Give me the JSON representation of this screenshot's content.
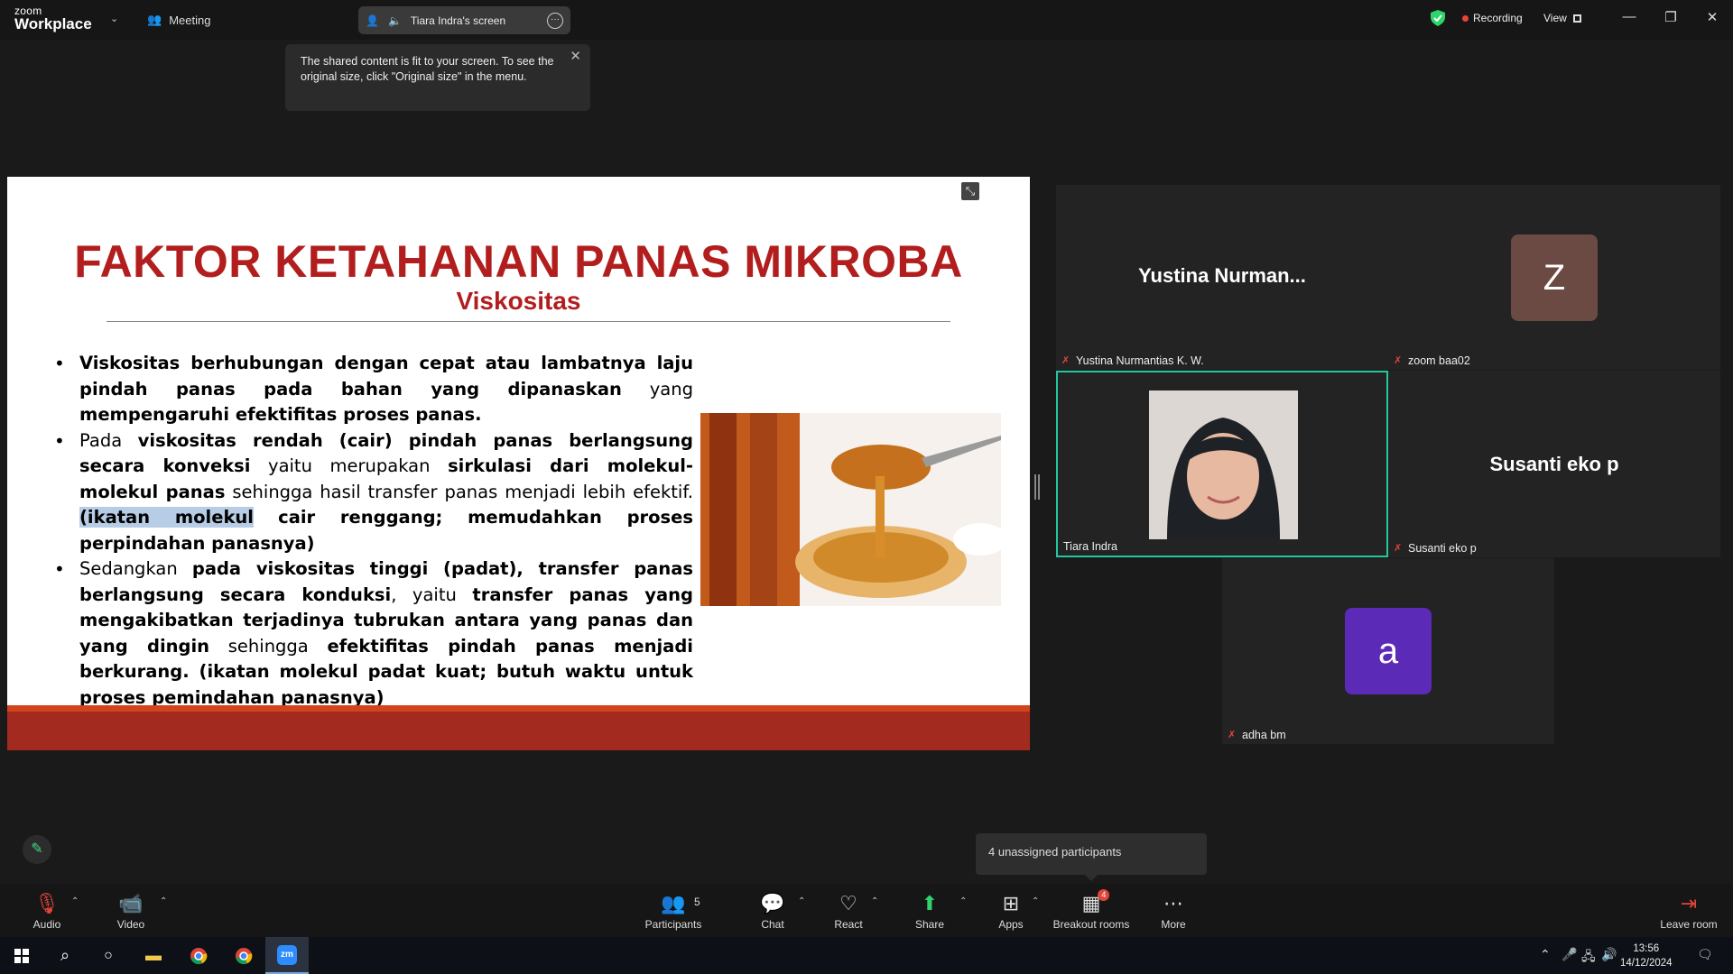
{
  "topbar": {
    "brand_line1": "zoom",
    "brand_line2": "Workplace",
    "meeting_label": "Meeting",
    "share_pill_label": "Tiara Indra's screen",
    "recording_label": "Recording",
    "view_label": "View"
  },
  "tooltip": {
    "text": "The shared content is fit to your screen. To see the original size, click \"Original size\" in the menu."
  },
  "slide": {
    "title": "FAKTOR KETAHANAN PANAS MIKROBA",
    "subtitle": "Viskositas"
  },
  "participants": {
    "tile1_big_name": "Yustina  Nurman...",
    "tile1_tag": "Yustina Nurmantias K. W.",
    "tile2_avatar": "Z",
    "tile2_tag": "zoom baa02",
    "tile3_tag": "Tiara Indra",
    "tile4_big_name": "Susanti eko p",
    "tile4_tag": "Susanti eko p",
    "tile5_avatar": "a",
    "tile5_tag": "adha bm",
    "avatar_z_color": "#6b4a43",
    "avatar_a_color": "#5b2bb8",
    "active_speaker_border": "#22c7a0"
  },
  "unassigned_label": "4 unassigned participants",
  "toolbar": {
    "audio": "Audio",
    "video": "Video",
    "participants": "Participants",
    "participants_count": "5",
    "chat": "Chat",
    "react": "React",
    "share": "Share",
    "apps": "Apps",
    "breakout": "Breakout rooms",
    "breakout_badge": "4",
    "more": "More",
    "leave": "Leave room"
  },
  "taskbar": {
    "time": "13:56",
    "date": "14/12/2024"
  },
  "colors": {
    "slide_title": "#b21e1e",
    "slide_band": "#a32a1f",
    "share_green": "#2fd56b"
  }
}
